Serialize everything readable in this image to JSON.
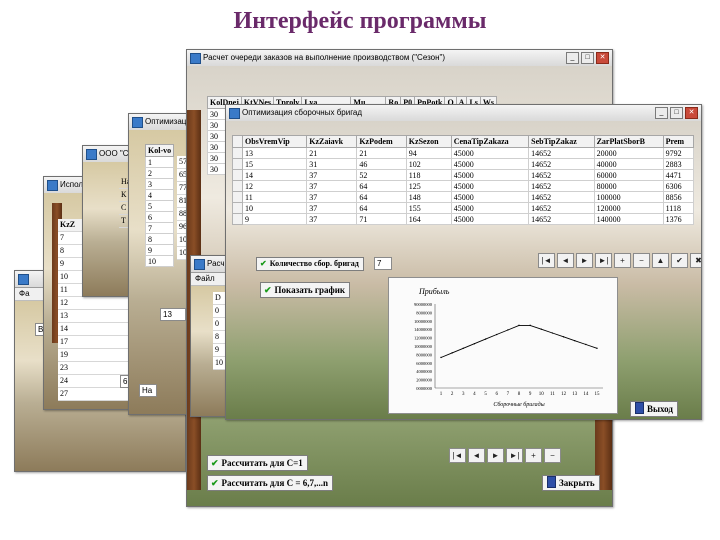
{
  "slide_title": "Интерфейс программы",
  "win_main": {
    "title": "Расчет очереди заказов на выполнение производством (\"Сезон\")",
    "columns": [
      "KolDnej",
      "KtVNes",
      "Tprolv",
      "Lya",
      "Mu",
      "Ro",
      "P0",
      "PnPotk",
      "Q",
      "A",
      "Ls",
      "Ws"
    ],
    "rows": [
      [
        "30"
      ],
      [
        "30"
      ],
      [
        "30"
      ],
      [
        "30"
      ],
      [
        "30"
      ],
      [
        "30"
      ]
    ],
    "btn_calc1": "Рассчитать для C=1",
    "btn_calc2": "Рассчитать для C = 6,7,...n",
    "btn_close": "Закрыть",
    "nav": [
      "|◄",
      "◄",
      "►",
      "►|",
      "+",
      "−"
    ]
  },
  "win_brigade_back": {
    "title": "Оптимизация сборочных",
    "columns": [
      "Kol-vo"
    ],
    "rows": [
      "1",
      "2",
      "3",
      "4",
      "5",
      "6",
      "7",
      "8",
      "9",
      "10"
    ],
    "values": [
      "57",
      "65",
      "77",
      "81",
      "88",
      "96",
      "10",
      "1060"
    ],
    "prefix": [
      "Ha"
    ]
  },
  "win_ooo": {
    "title": "ООО \"Сезон\"",
    "labels": [
      "На",
      "К",
      "С",
      "Т"
    ]
  },
  "win_left": {
    "title": "Использование",
    "column": "KzZ",
    "rows": [
      "7",
      "8",
      "9",
      "10",
      "11",
      "12",
      "13",
      "14",
      "17",
      "19",
      "23",
      "24",
      "27"
    ],
    "bottom_value": "6"
  },
  "win_small_front": {
    "title": "Расч",
    "menu": "Файл",
    "rows": [
      "D",
      "0",
      "0",
      "8",
      "9",
      "10"
    ],
    "value": "13"
  },
  "win_far_left": {
    "menu": "Фа",
    "labels": [
      "Ba"
    ]
  },
  "win_front": {
    "title": "Оптимизация сборочных бригад",
    "columns": [
      "ObsVremVip",
      "KzZaiavk",
      "KzPodem",
      "KzSezon",
      "CenaTipZakaza",
      "SebTipZakaz",
      "ZarPlatSborB",
      "Prem"
    ],
    "rows": [
      [
        "13",
        "21",
        "21",
        "94",
        "45000",
        "14652",
        "20000",
        "9792"
      ],
      [
        "15",
        "31",
        "46",
        "102",
        "45000",
        "14652",
        "40000",
        "2883"
      ],
      [
        "14",
        "37",
        "52",
        "118",
        "45000",
        "14652",
        "60000",
        "4471"
      ],
      [
        "12",
        "37",
        "64",
        "125",
        "45000",
        "14652",
        "80000",
        "6306"
      ],
      [
        "11",
        "37",
        "64",
        "148",
        "45000",
        "14652",
        "100000",
        "8856"
      ],
      [
        "10",
        "37",
        "64",
        "155",
        "45000",
        "14652",
        "120000",
        "1118"
      ],
      [
        "9",
        "37",
        "71",
        "164",
        "45000",
        "14652",
        "140000",
        "1376"
      ]
    ],
    "brigade_label": "Количество сбор. бригад",
    "brigade_value": "7",
    "btn_show_chart": "Показать график",
    "btn_exit": "Выход",
    "nav": [
      "|◄",
      "◄",
      "►",
      "►|",
      "+",
      "−",
      "▲",
      "✔",
      "✖",
      "↻"
    ]
  },
  "chart_data": {
    "type": "line",
    "title": "Прибыль",
    "xlabel": "Сборочные бригады",
    "ylabel": "",
    "x": [
      1,
      2,
      3,
      4,
      5,
      6,
      7,
      8,
      9,
      10,
      11,
      12,
      13,
      14,
      15
    ],
    "series": [
      {
        "values": [
          4000000,
          4600000,
          5200000,
          5800000,
          6400000,
          7000000,
          7600000,
          8200000,
          8200000,
          7700000,
          7200000,
          6700000,
          6200000,
          5700000,
          5200000
        ]
      }
    ],
    "ytick_labels": [
      "90000000",
      "8000000",
      "10000000",
      "14000000",
      "12000000",
      "10000000",
      "8000000",
      "6000000",
      "4000000",
      "2000000",
      "0000000"
    ],
    "xtick_labels": [
      "1",
      "2",
      "3",
      "4",
      "5",
      "6",
      "7",
      "8",
      "9",
      "10",
      "11",
      "12",
      "13",
      "14",
      "15"
    ],
    "ylim": [
      0,
      11000000
    ],
    "line_color": "#000000",
    "grid": false
  }
}
